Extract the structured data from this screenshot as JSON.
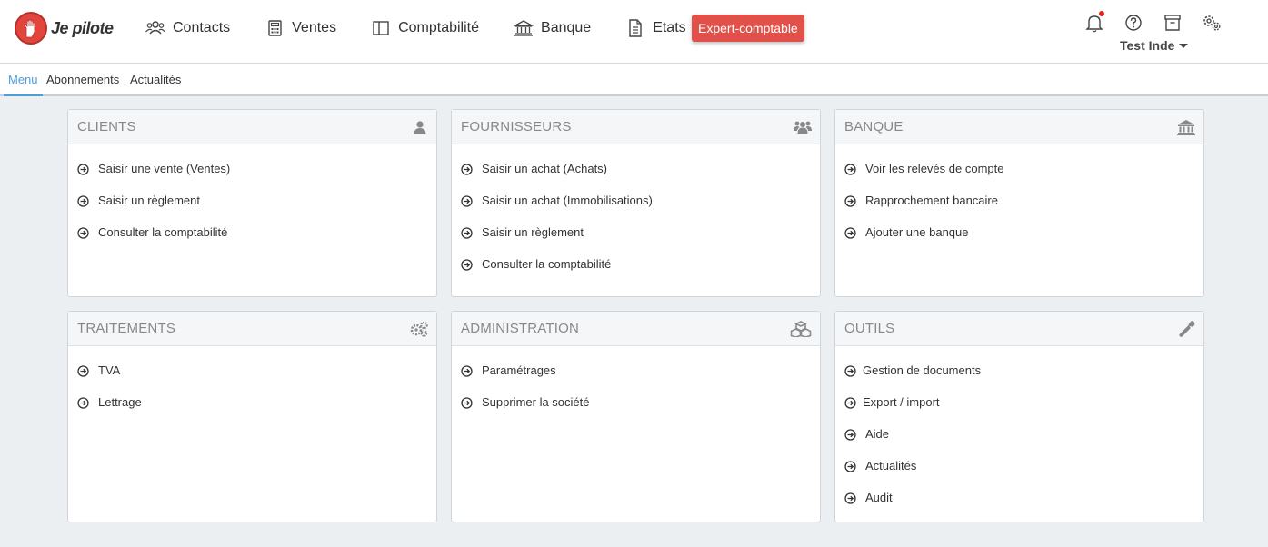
{
  "app": {
    "logo_text": "Je pilote"
  },
  "nav": {
    "items": [
      {
        "label": "Contacts",
        "icon": "users-icon"
      },
      {
        "label": "Ventes",
        "icon": "calculator-icon"
      },
      {
        "label": "Comptabilité",
        "icon": "book-icon"
      },
      {
        "label": "Banque",
        "icon": "bank-icon"
      },
      {
        "label": "Etats",
        "icon": "document-icon"
      }
    ],
    "expert_label": "Expert-comptable",
    "expert_color": "#e2504a"
  },
  "user": {
    "name": "Test Inde"
  },
  "tabs": [
    {
      "label": "Menu",
      "active": true
    },
    {
      "label": "Abonnements",
      "active": false
    },
    {
      "label": "Actualités",
      "active": false
    }
  ],
  "panels": {
    "clients": {
      "title": "CLIENTS",
      "icon": "user-icon",
      "links": [
        "Saisir une vente (Ventes)",
        "Saisir un règlement",
        "Consulter la comptabilité"
      ]
    },
    "fournisseurs": {
      "title": "FOURNISSEURS",
      "icon": "group-icon",
      "links": [
        "Saisir un achat (Achats)",
        "Saisir un achat (Immobilisations)",
        "Saisir un règlement",
        "Consulter la comptabilité"
      ]
    },
    "banque": {
      "title": "BANQUE",
      "icon": "bank-icon",
      "links": [
        "Voir les relevés de compte",
        "Rapprochement bancaire",
        "Ajouter une banque"
      ]
    },
    "traitements": {
      "title": "TRAITEMENTS",
      "icon": "gears-icon",
      "links": [
        "TVA",
        "Lettrage"
      ]
    },
    "administration": {
      "title": "ADMINISTRATION",
      "icon": "cubes-icon",
      "links": [
        "Paramétrages",
        "Supprimer la société"
      ]
    },
    "outils": {
      "title": "OUTILS",
      "icon": "wrench-icon",
      "links": [
        "Gestion de documents",
        "Export / import",
        "Aide",
        "Actualités",
        "Audit"
      ]
    }
  },
  "colors": {
    "accent": "#4a9edb",
    "background": "#eceff2"
  }
}
